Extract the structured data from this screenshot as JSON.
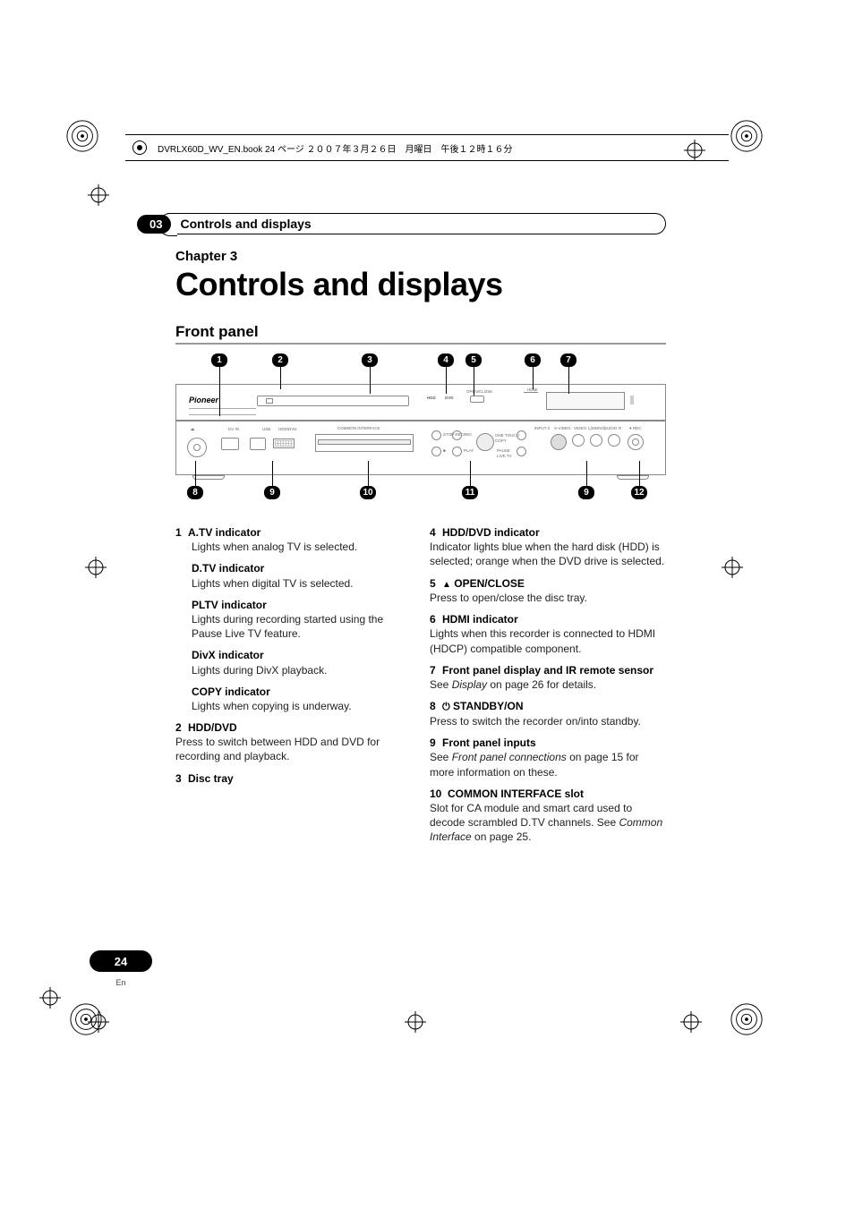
{
  "book_header": "DVRLX60D_WV_EN.book  24 ページ  ２００７年３月２６日　月曜日　午後１２時１６分",
  "section_number": "03",
  "section_title": "Controls and displays",
  "chapter_label": "Chapter 3",
  "chapter_title": "Controls and displays",
  "panel_heading": "Front panel",
  "callouts_top": [
    "1",
    "2",
    "3",
    "4",
    "5",
    "6",
    "7"
  ],
  "callouts_bottom": [
    "8",
    "9",
    "10",
    "11",
    "9",
    "12"
  ],
  "panel_labels": {
    "logo": "Pioneer",
    "hdd": "HDD",
    "dvd": "DVD",
    "openclose": "OPEN/CLOSE",
    "hdmi": "HDMI",
    "dvin": "DV IN",
    "usb": "USB",
    "hdddvd": "HDD/DVD",
    "ci": "COMMON INTERFACE",
    "stoprec": "STOP REC",
    "rec": "REC",
    "onetouch1": "ONE TOUCH",
    "onetouch2": "COPY",
    "stop": "STOP",
    "play": "PLAY",
    "pauselive": "PAUSE",
    "livetv": "LIVE TV",
    "input2": "INPUT 2",
    "svideo": "S-VIDEO",
    "video": "VIDEO",
    "laudio": "L(MONO)",
    "audio": "AUDIO",
    "r": "R",
    "recdot": "REC"
  },
  "left_items": [
    {
      "num": "1",
      "title": "A.TV indicator",
      "desc": "Lights when analog TV is selected.",
      "subhead": true
    },
    {
      "title": "D.TV indicator",
      "desc": "Lights when digital TV is selected.",
      "subhead": true
    },
    {
      "title": "PLTV indicator",
      "desc": "Lights during recording started using the Pause Live TV feature.",
      "subhead": true
    },
    {
      "title": "DivX indicator",
      "desc": "Lights during DivX playback.",
      "subhead": true
    },
    {
      "title": "COPY indicator",
      "desc": "Lights when copying is underway.",
      "subhead": true
    },
    {
      "num": "2",
      "title": "HDD/DVD",
      "desc": "Press to switch between HDD and DVD for recording and playback."
    },
    {
      "num": "3",
      "title": "Disc tray",
      "desc": ""
    }
  ],
  "right_items": [
    {
      "num": "4",
      "title": "HDD/DVD indicator",
      "desc": "Indicator lights blue when the hard disk (HDD) is selected; orange when the DVD drive is selected."
    },
    {
      "num": "5",
      "icon": "eject",
      "title": "OPEN/CLOSE",
      "desc": "Press to open/close the disc tray."
    },
    {
      "num": "6",
      "title": "HDMI indicator",
      "desc": "Lights when this recorder is connected to HDMI (HDCP) compatible component."
    },
    {
      "num": "7",
      "title": "Front panel display and IR remote sensor",
      "desc_pre": "See ",
      "desc_ital": "Display",
      "desc_post": " on page 26 for details."
    },
    {
      "num": "8",
      "icon": "power",
      "title": "STANDBY/ON",
      "desc": "Press to switch the recorder on/into standby."
    },
    {
      "num": "9",
      "title": "Front panel inputs",
      "desc_pre": "See ",
      "desc_ital": "Front panel connections",
      "desc_post": " on page 15 for more information on these."
    },
    {
      "num": "10",
      "title": "COMMON INTERFACE slot",
      "desc_pre": "Slot for CA module and smart card used to decode scrambled D.TV channels. See ",
      "desc_ital": "Common Interface",
      "desc_post": " on page 25."
    }
  ],
  "page_number": "24",
  "page_lang": "En"
}
